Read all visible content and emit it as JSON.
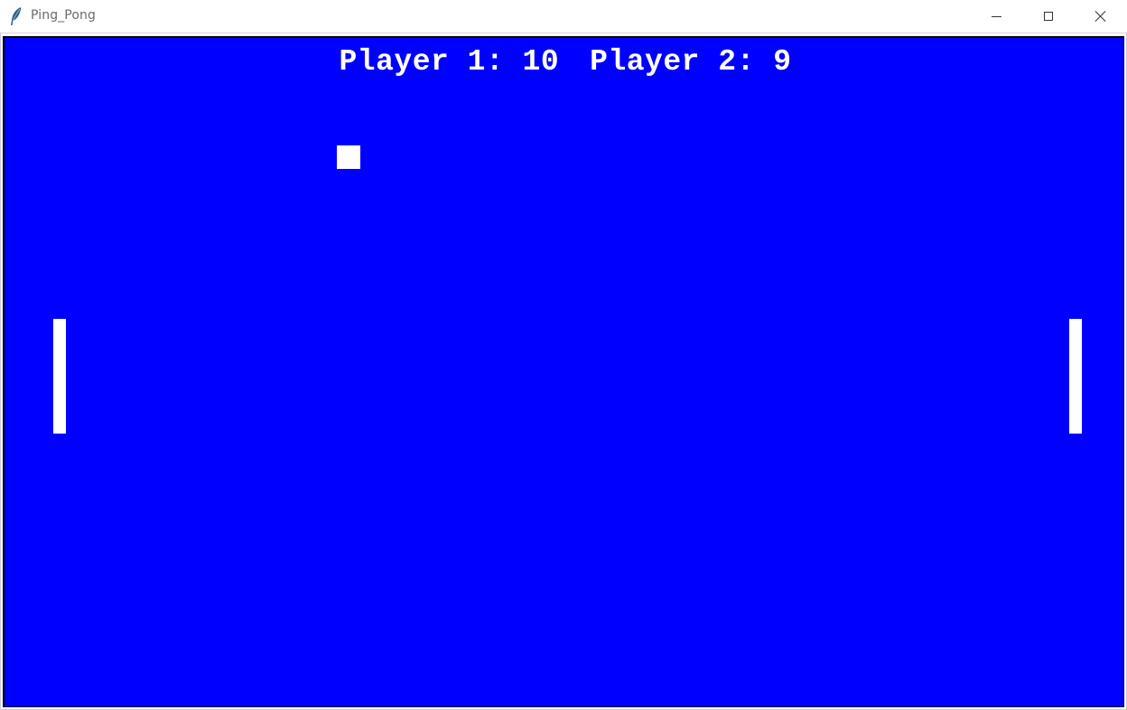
{
  "window": {
    "title": "Ping_Pong",
    "icon": "feather-icon",
    "controls": {
      "minimize_icon": "minimize-icon",
      "maximize_icon": "maximize-icon",
      "close_icon": "close-icon"
    }
  },
  "game": {
    "background_color": "#0000ff",
    "foreground_color": "#ffffff",
    "score": {
      "player1_label": "Player 1:",
      "player1_value": "10",
      "player2_label": "Player 2:",
      "player2_value": "9"
    }
  }
}
